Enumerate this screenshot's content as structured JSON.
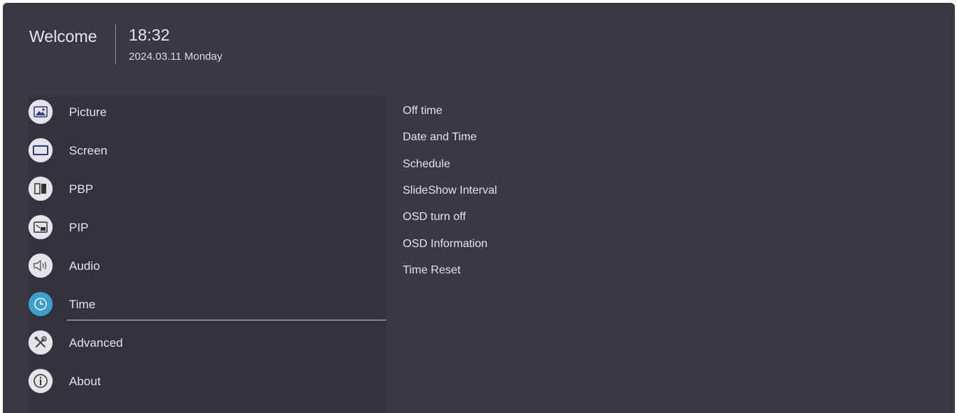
{
  "header": {
    "welcome": "Welcome",
    "time": "18:32",
    "date": "2024.03.11 Monday"
  },
  "sidebar": {
    "items": [
      {
        "label": "Picture",
        "icon": "picture-icon"
      },
      {
        "label": "Screen",
        "icon": "screen-icon"
      },
      {
        "label": "PBP",
        "icon": "pbp-icon"
      },
      {
        "label": "PIP",
        "icon": "pip-icon"
      },
      {
        "label": "Audio",
        "icon": "speaker-icon"
      },
      {
        "label": "Time",
        "icon": "clock-icon",
        "selected": true
      },
      {
        "label": "Advanced",
        "icon": "tools-icon"
      },
      {
        "label": "About",
        "icon": "info-icon"
      }
    ]
  },
  "submenu": {
    "items": [
      "Off time",
      "Date and Time",
      "Schedule",
      "SlideShow Interval",
      "OSD turn off",
      "OSD Information",
      "Time Reset"
    ]
  },
  "colors": {
    "panel_bg": "#393843",
    "sidebar_bg": "#33323d",
    "accent": "#3aa0c9",
    "icon_fg": "#2f3a78"
  }
}
